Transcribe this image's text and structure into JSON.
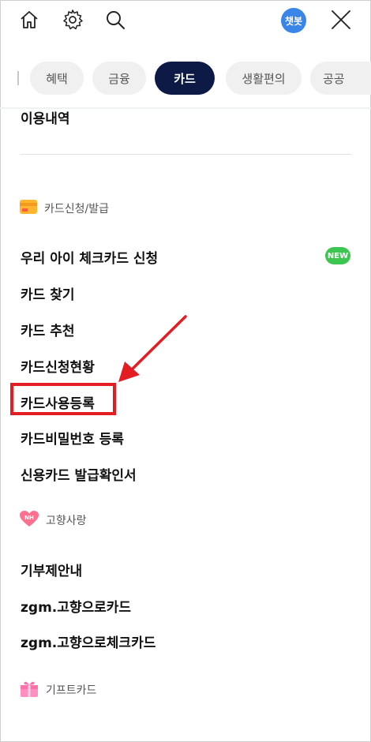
{
  "topbar": {
    "home_icon": "home-icon",
    "settings_icon": "gear-icon",
    "search_icon": "search-icon",
    "chatbot_label": "챗봇",
    "close_icon": "close-icon"
  },
  "tabs": [
    {
      "label": "혜택",
      "active": false
    },
    {
      "label": "금융",
      "active": false
    },
    {
      "label": "카드",
      "active": true
    },
    {
      "label": "생활편의",
      "active": false
    },
    {
      "label": "공공",
      "active": false
    }
  ],
  "menu": {
    "partial_item": "이용내역",
    "card_section": {
      "title": "카드신청/발급",
      "items": [
        "우리 아이 체크카드 신청",
        "카드 찾기",
        "카드 추천",
        "카드신청현황",
        "카드사용등록",
        "카드비밀번호 등록",
        "신용카드 발급확인서"
      ],
      "new_badge": "NEW"
    },
    "hometown_section": {
      "title": "고향사랑",
      "icon_text": "NH",
      "items": [
        "기부제안내",
        "zgm.고향으로카드",
        "zgm.고향으로체크카드"
      ]
    },
    "gift_section": {
      "title": "기프트카드"
    }
  },
  "colors": {
    "active_tab": "#0d1a45",
    "chatbot": "#3a86e8",
    "new_badge": "#3dc64f",
    "highlight": "#e41d23"
  }
}
